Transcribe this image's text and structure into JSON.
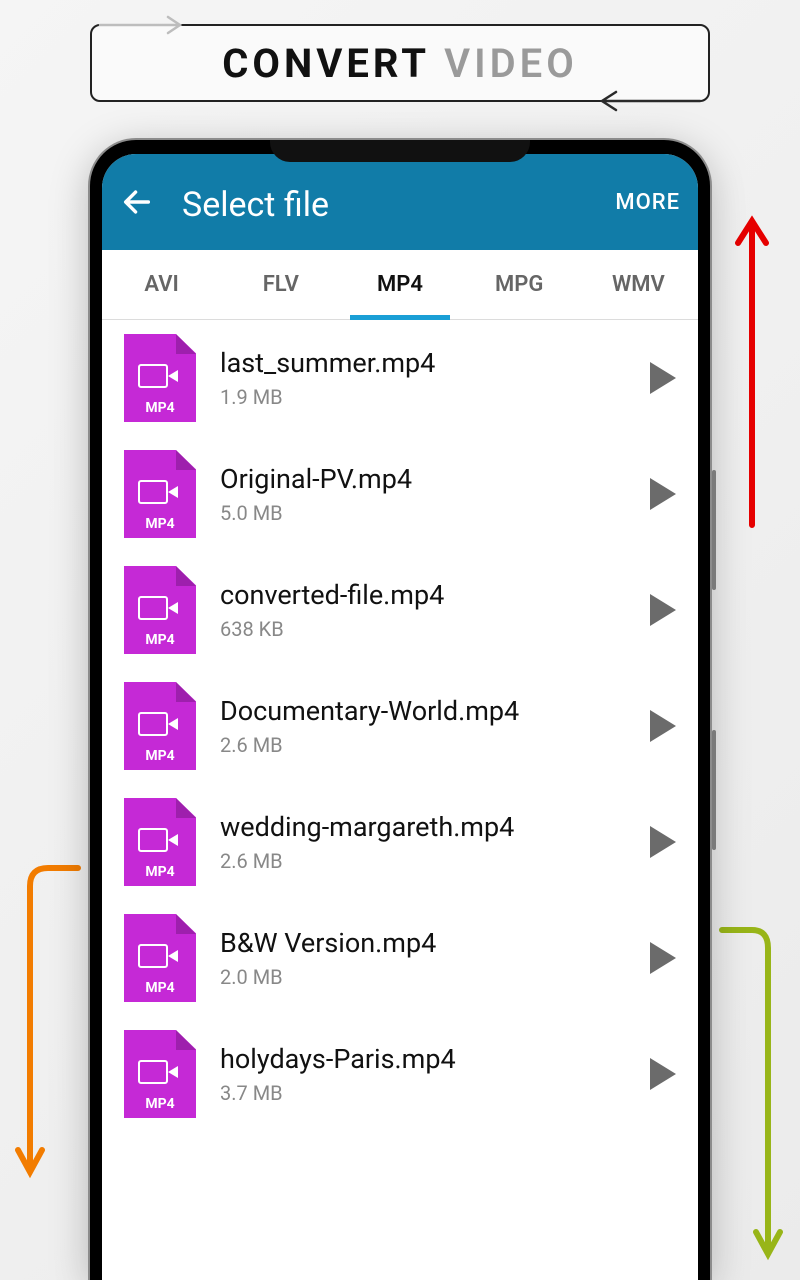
{
  "banner": {
    "word1": "CONVERT",
    "word2": "VIDEO"
  },
  "appbar": {
    "title": "Select file",
    "more": "MORE"
  },
  "tabs": [
    {
      "label": "AVI",
      "active": false
    },
    {
      "label": "FLV",
      "active": false
    },
    {
      "label": "MP4",
      "active": true
    },
    {
      "label": "MPG",
      "active": false
    },
    {
      "label": "WMV",
      "active": false
    }
  ],
  "file_icon_label": "MP4",
  "files": [
    {
      "name": "last_summer.mp4",
      "size": "1.9 MB"
    },
    {
      "name": "Original-PV.mp4",
      "size": "5.0 MB"
    },
    {
      "name": "converted-file.mp4",
      "size": "638 KB"
    },
    {
      "name": "Documentary-World.mp4",
      "size": "2.6 MB"
    },
    {
      "name": "wedding-margareth.mp4",
      "size": "2.6 MB"
    },
    {
      "name": "B&W Version.mp4",
      "size": "2.0 MB"
    },
    {
      "name": "holydays-Paris.mp4",
      "size": "3.7 MB"
    }
  ]
}
